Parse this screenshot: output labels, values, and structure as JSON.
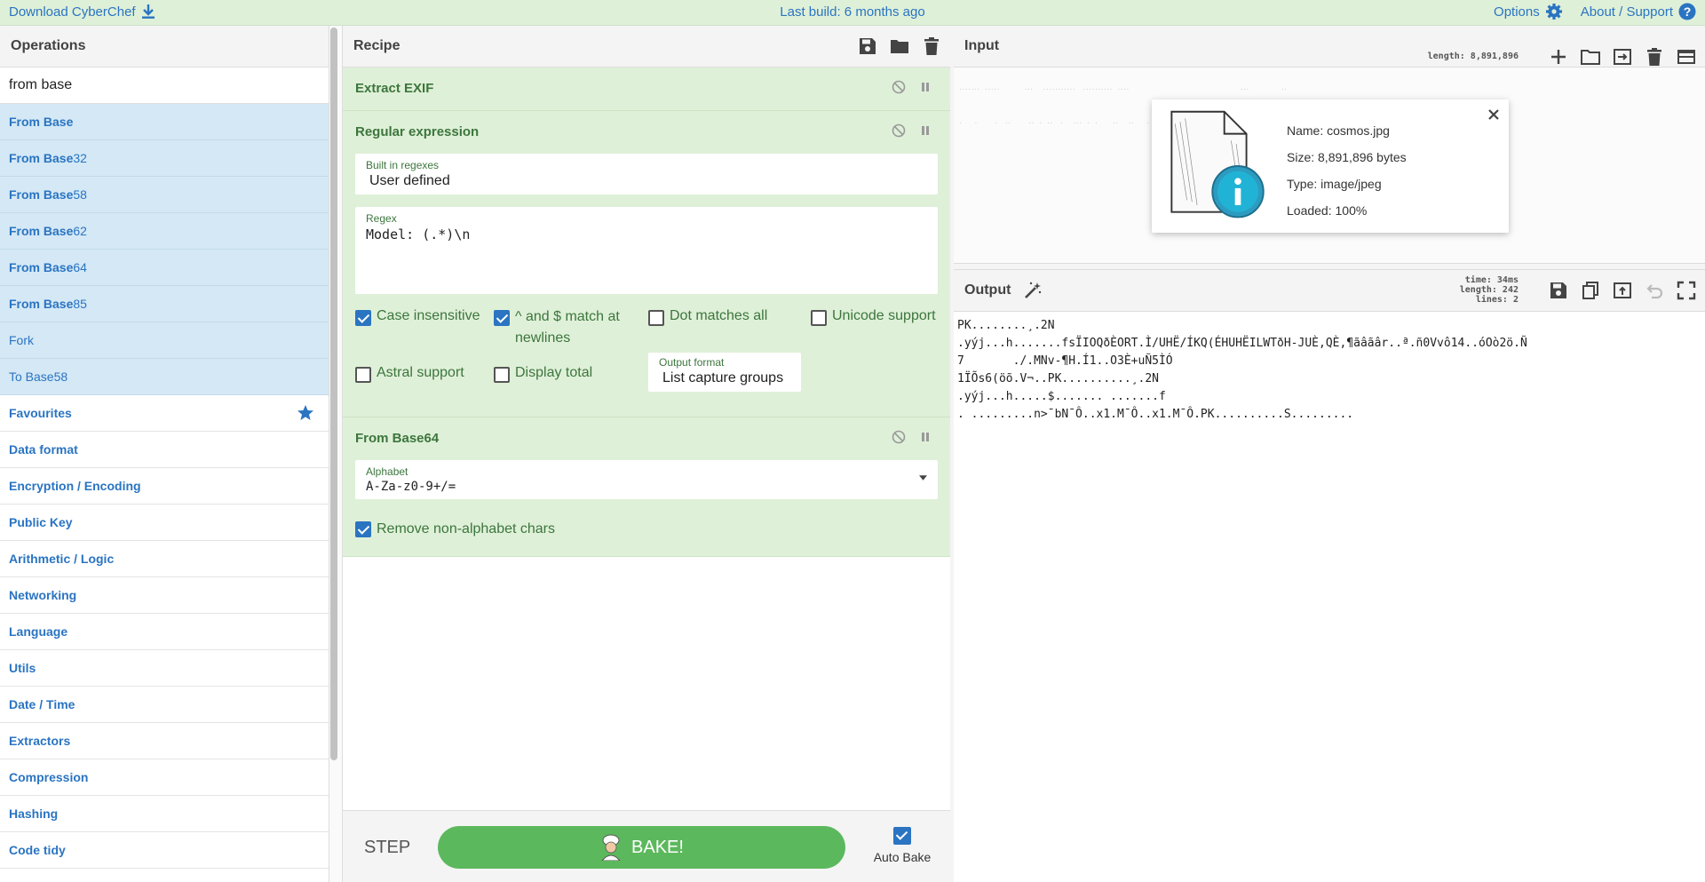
{
  "banner": {
    "download_label": "Download CyberChef",
    "build_label": "Last build: 6 months ago",
    "options_label": "Options",
    "about_label": "About / Support"
  },
  "operations": {
    "title": "Operations",
    "search_value": "from base",
    "matches": [
      {
        "bold": "From Base",
        "rest": ""
      },
      {
        "bold": "From Base",
        "rest": "32"
      },
      {
        "bold": "From Base",
        "rest": "58"
      },
      {
        "bold": "From Base",
        "rest": "62"
      },
      {
        "bold": "From Base",
        "rest": "64"
      },
      {
        "bold": "From Base",
        "rest": "85"
      },
      {
        "bold": "",
        "rest": "Fork"
      },
      {
        "bold": "",
        "rest": "To Base58"
      }
    ],
    "categories": [
      "Favourites",
      "Data format",
      "Encryption / Encoding",
      "Public Key",
      "Arithmetic / Logic",
      "Networking",
      "Language",
      "Utils",
      "Date / Time",
      "Extractors",
      "Compression",
      "Hashing",
      "Code tidy"
    ]
  },
  "recipe": {
    "title": "Recipe",
    "op1": {
      "title": "Extract EXIF"
    },
    "op2": {
      "title": "Regular expression",
      "builtin_label": "Built in regexes",
      "builtin_value": "User defined",
      "regex_label": "Regex",
      "regex_value": "Model: (.*)\\n",
      "chk_case": "Case insensitive",
      "chk_multiline": "^ and $ match at newlines",
      "chk_dotall": "Dot matches all",
      "chk_unicode": "Unicode support",
      "chk_astral": "Astral support",
      "chk_total": "Display total",
      "format_label": "Output format",
      "format_value": "List capture groups"
    },
    "op3": {
      "title": "From Base64",
      "alphabet_label": "Alphabet",
      "alphabet_value": "A-Za-z0-9+/=",
      "chk_remove": "Remove non-alphabet chars"
    },
    "step_label": "STEP",
    "bake_label": "BAKE!",
    "autobake_label": "Auto Bake"
  },
  "input": {
    "title": "Input",
    "length_label": "length: 8,891,896",
    "file_name": "Name: cosmos.jpg",
    "file_size": "Size: 8,891,896 bytes",
    "file_type": "Type: image/jpeg",
    "file_loaded": "Loaded: 100%"
  },
  "output": {
    "title": "Output",
    "stat_time": "time: 34ms",
    "stat_length": "length: 242",
    "stat_lines": "lines: 2",
    "text": "PK........¸.2N\n.yýj...h.......fsÏIOQðÈORT.Ì/UHË/ÍKQ(ÉHUHËILWTðH-JUÈ,QÈ,¶ãâãâr..ª.ñ0Vvô14..óOò2ö.Ñ\n7       ./.MNv-¶H.Í1..O3È+uÑ5ÌÓ\n1ÏÕs6(öõ.V¬..PK..........¸.2N\n.yýj...h.....$....... .......f\n. .........n>¯bN¯Ô..x1.M¯Ô..x1.M¯Ô.PK..........S........."
  }
}
